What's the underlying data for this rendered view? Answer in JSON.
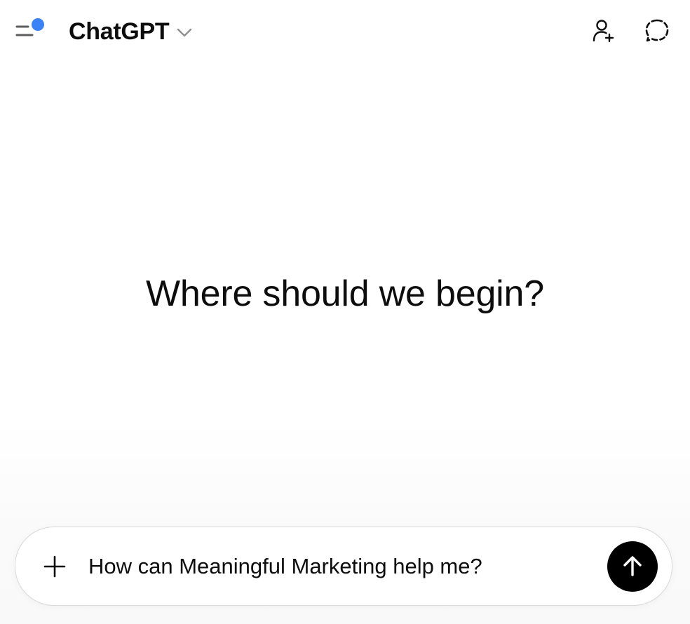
{
  "header": {
    "model_name": "ChatGPT",
    "icons": {
      "sidebar_toggle": "sidebar-toggle-icon",
      "notification_dot_color": "#3b82f6",
      "model_chevron": "chevron-down-icon",
      "share": "add-person-icon",
      "temporary_chat": "dashed-chat-bubble-icon"
    }
  },
  "main": {
    "greeting": "Where should we begin?"
  },
  "composer": {
    "input_value": "How can Meaningful Marketing help me?",
    "icons": {
      "add": "plus-icon",
      "send": "arrow-up-icon"
    },
    "send_button_color": "#000000"
  }
}
